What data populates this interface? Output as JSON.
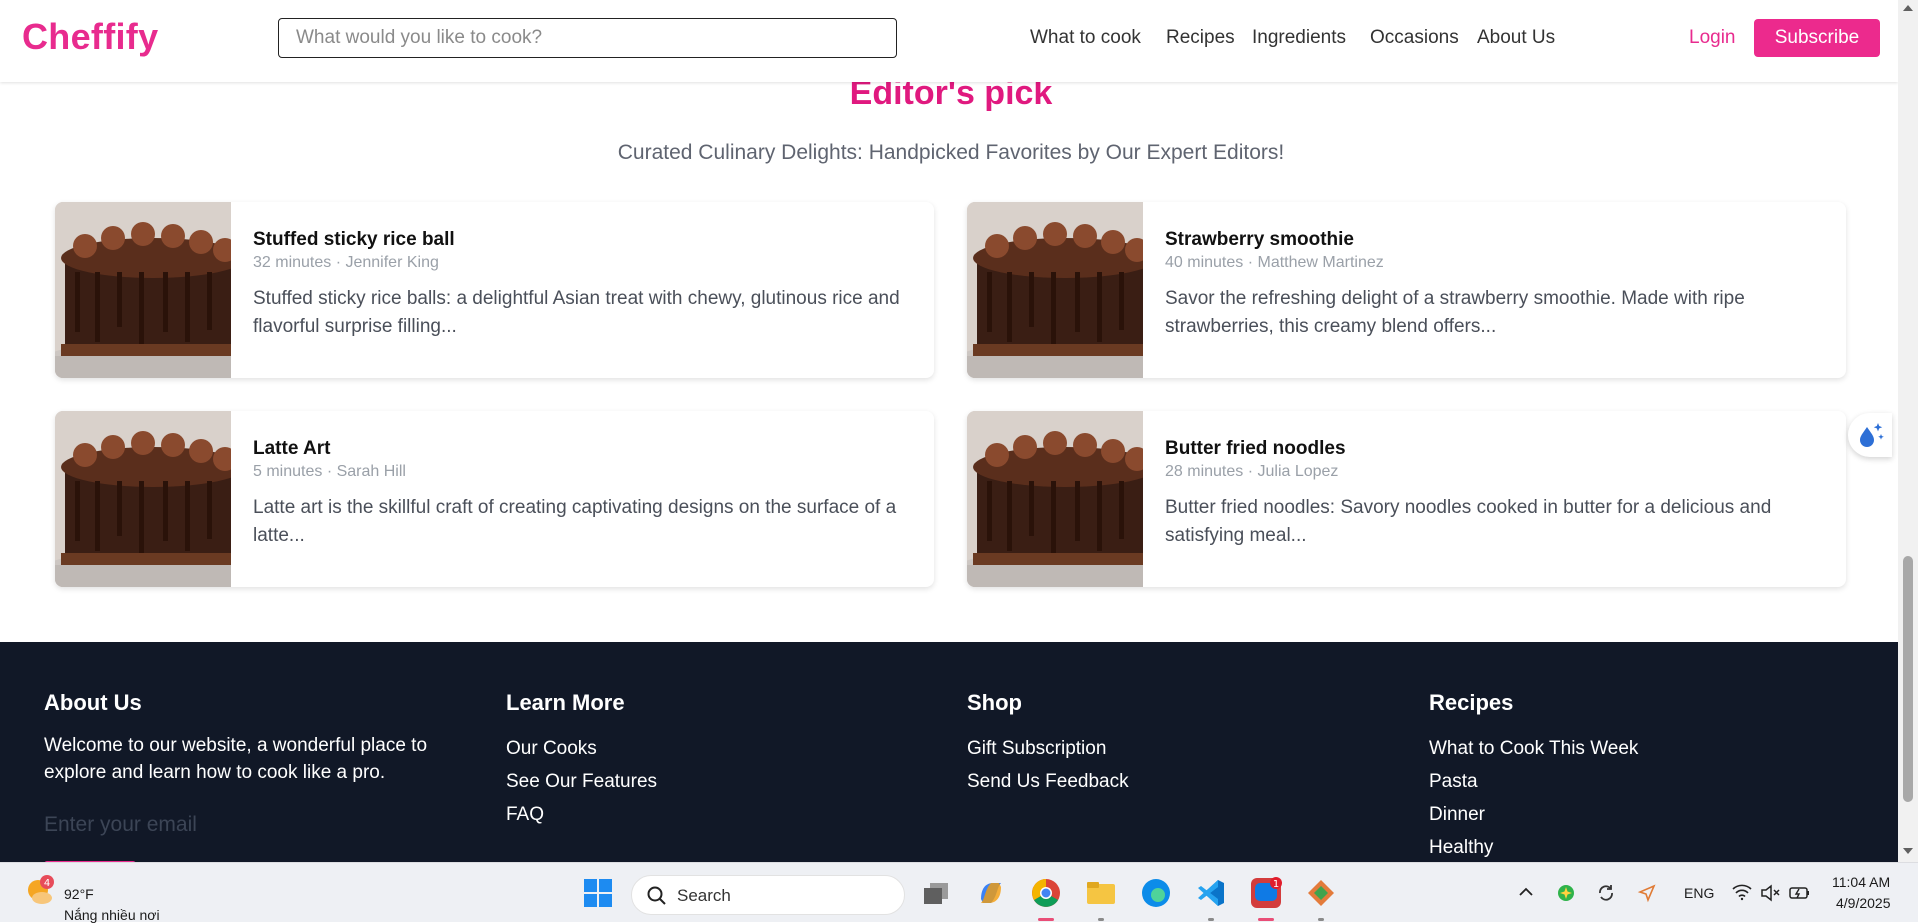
{
  "header": {
    "logo": "Cheffify",
    "search_placeholder": "What would you like to cook?",
    "nav": [
      "What to cook",
      "Recipes",
      "Ingredients",
      "Occasions",
      "About Us"
    ],
    "login": "Login",
    "subscribe": "Subscribe"
  },
  "editors_pick": {
    "title": "Editor's pick",
    "subtitle": "Curated Culinary Delights: Handpicked Favorites by Our Expert Editors!",
    "cards": [
      {
        "title": "Stuffed sticky rice ball",
        "meta": "32 minutes · Jennifer King",
        "desc": "Stuffed sticky rice balls: a delightful Asian treat with chewy, glutinous rice and flavorful surprise filling..."
      },
      {
        "title": "Strawberry smoothie",
        "meta": "40 minutes · Matthew Martinez",
        "desc": "Savor the refreshing delight of a strawberry smoothie. Made with ripe strawberries, this creamy blend offers..."
      },
      {
        "title": "Latte Art",
        "meta": "5 minutes · Sarah Hill",
        "desc": "Latte art is the skillful craft of creating captivating designs on the surface of a latte..."
      },
      {
        "title": "Butter fried noodles",
        "meta": "28 minutes · Julia Lopez",
        "desc": "Butter fried noodles: Savory noodles cooked in butter for a delicious and satisfying meal..."
      }
    ]
  },
  "footer": {
    "about": {
      "heading": "About Us",
      "text": "Welcome to our website, a wonderful place to explore and learn how to cook like a pro.",
      "email_placeholder": "Enter your email"
    },
    "learn_more": {
      "heading": "Learn More",
      "links": [
        "Our Cooks",
        "See Our Features",
        "FAQ"
      ]
    },
    "shop": {
      "heading": "Shop",
      "links": [
        "Gift Subscription",
        "Send Us Feedback"
      ]
    },
    "recipes": {
      "heading": "Recipes",
      "links": [
        "What to Cook This Week",
        "Pasta",
        "Dinner",
        "Healthy"
      ]
    }
  },
  "taskbar": {
    "weather_temp": "92°F",
    "weather_desc": "Nắng nhiều nơi",
    "weather_badge": "4",
    "search_label": "Search",
    "zalo_badge": "1",
    "lang": "ENG",
    "time": "11:04 AM",
    "date": "4/9/2025"
  },
  "colors": {
    "brand": "#e82b8e",
    "footer_bg": "#111827",
    "taskbar_bg": "#eef0f4"
  }
}
